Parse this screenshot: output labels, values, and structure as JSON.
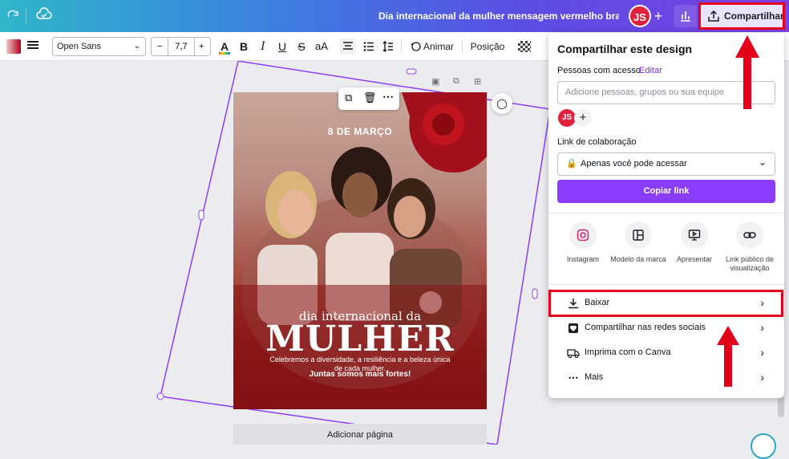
{
  "topbar": {
    "title": "Dia internacional da mulher mensagem vermelho branco p...",
    "avatar_initials": "JS",
    "share_label": "Compartilhar"
  },
  "toolbar": {
    "font_name": "Open Sans",
    "font_size": "7,7",
    "minus": "−",
    "plus": "+",
    "bold": "B",
    "italic": "I",
    "underline": "U",
    "strike": "S",
    "case": "aA",
    "animate_label": "Animar",
    "position_label": "Posição"
  },
  "poster": {
    "date": "8 DE MARÇO",
    "subtitle": "dia internacional da",
    "title": "MULHER",
    "body": "Celebremos a diversidade, a resiliência e a beleza única de cada mulher.",
    "cta": "Juntas somos mais fortes!"
  },
  "canvas": {
    "add_page": "Adicionar página"
  },
  "share_panel": {
    "title": "Compartilhar este design",
    "people_label": "Pessoas com acesso",
    "edit_label": "Editar",
    "invite_placeholder": "Adicione pessoas, grupos ou sua equipe",
    "member_initials": "JS",
    "link_label": "Link de colaboração",
    "access_option": "Apenas você pode acessar",
    "copy_link": "Copiar link",
    "options": [
      {
        "label": "Instagram",
        "icon": "instagram-icon"
      },
      {
        "label": "Modelo da marca",
        "icon": "brand-template-icon"
      },
      {
        "label": "Apresentar",
        "icon": "present-icon"
      },
      {
        "label": "Link público de visualização",
        "icon": "link-icon"
      }
    ],
    "rows": [
      {
        "label": "Baixar",
        "icon": "download-icon"
      },
      {
        "label": "Compartilhar nas redes sociais",
        "icon": "heart-icon"
      },
      {
        "label": "Imprima com o Canva",
        "icon": "truck-icon"
      },
      {
        "label": "Mais",
        "icon": "more-icon"
      }
    ]
  },
  "colors": {
    "highlight": "#e3001b",
    "accent": "#8b3dff",
    "avatar": "#e0223c"
  }
}
